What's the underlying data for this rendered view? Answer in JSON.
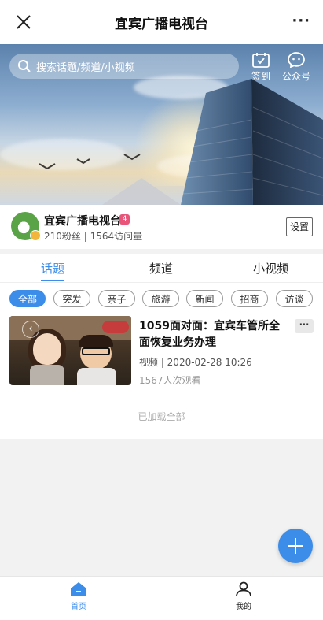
{
  "header": {
    "title": "宜宾广播电视台"
  },
  "search": {
    "placeholder": "搜索话题/频道/小视频"
  },
  "banner_actions": {
    "checkin": "签到",
    "official_account": "公众号"
  },
  "profile": {
    "name": "宜宾广播电视台",
    "rank": "4",
    "stats": "210粉丝 | 1564访问量",
    "settings": "设置"
  },
  "tabs": [
    "话题",
    "频道",
    "小视频"
  ],
  "chips": [
    "全部",
    "突发",
    "亲子",
    "旅游",
    "新闻",
    "招商",
    "访谈"
  ],
  "post": {
    "title": "1059面对面：宜宾车管所全面恢复业务办理",
    "meta": "视频 |  2020-02-28 10:26",
    "views": "1567人次观看"
  },
  "loaded_all": "已加载全部",
  "bottom_nav": {
    "home": "首页",
    "mine": "我的"
  },
  "colors": {
    "accent": "#3c8dea"
  }
}
